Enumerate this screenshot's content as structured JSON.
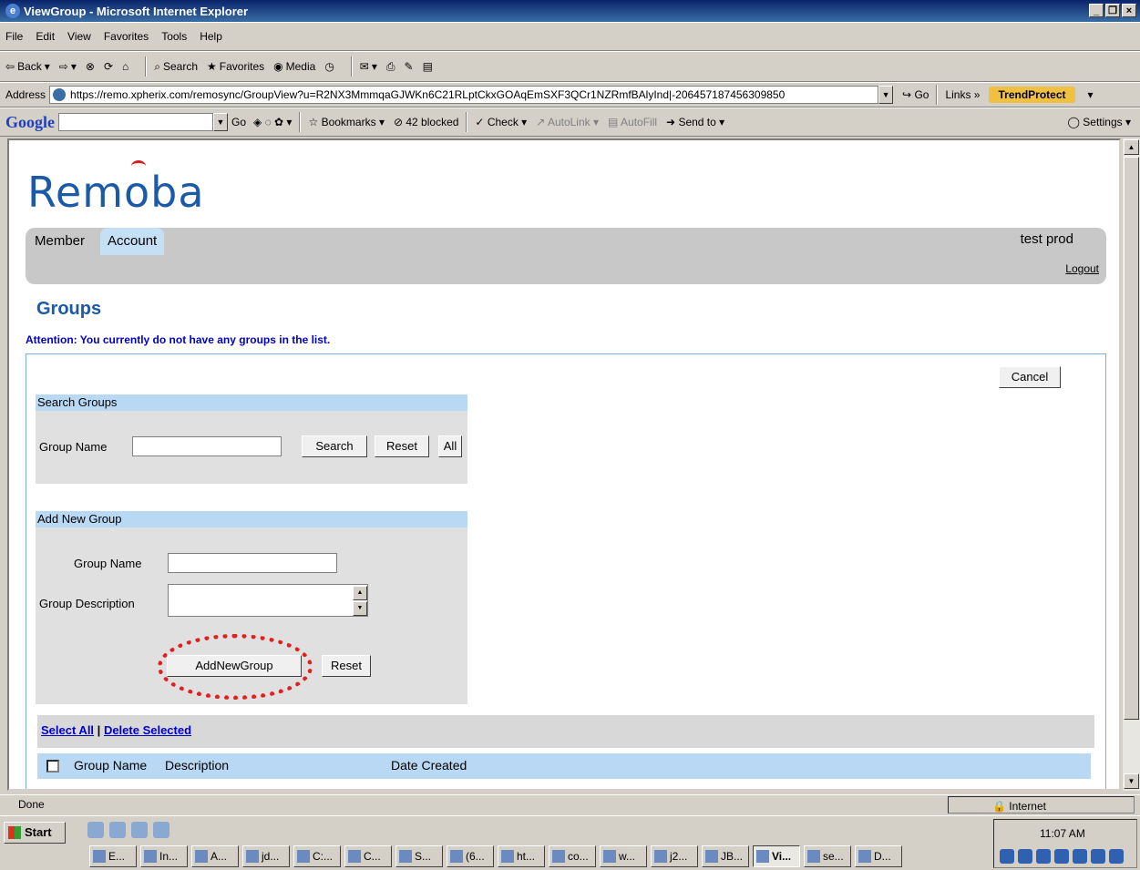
{
  "window": {
    "title": "ViewGroup - Microsoft Internet Explorer"
  },
  "menu": [
    "File",
    "Edit",
    "View",
    "Favorites",
    "Tools",
    "Help"
  ],
  "toolbar": {
    "back": "Back",
    "search": "Search",
    "favorites": "Favorites",
    "media": "Media"
  },
  "address": {
    "label": "Address",
    "url": "https://remo.xpherix.com/remosync/GroupView?u=R2NX3MmmqaGJWKn6C21RLptCkxGOAqEmSXF3QCr1NZRmfBAlyInd|-206457187456309850",
    "go": "Go",
    "links": "Links",
    "trend": "TrendProtect"
  },
  "google": {
    "logo": "Google",
    "go": "Go",
    "bookmarks": "Bookmarks",
    "blocked": "42 blocked",
    "check": "Check",
    "autolink": "AutoLink",
    "autofill": "AutoFill",
    "sendto": "Send to",
    "settings": "Settings"
  },
  "page": {
    "logo": "Remoba",
    "tabs": {
      "member": "Member",
      "account": "Account"
    },
    "user": "test prod",
    "logout": "Logout",
    "title": "Groups",
    "attention": "Attention: You currently do not have any groups in the list.",
    "cancel": "Cancel",
    "search_section": {
      "header": "Search Groups",
      "label": "Group Name",
      "value": "",
      "search": "Search",
      "reset": "Reset",
      "all": "All"
    },
    "add_section": {
      "header": "Add New Group",
      "name_label": "Group Name",
      "name_value": "",
      "desc_label": "Group Description",
      "desc_value": "",
      "add": "AddNewGroup",
      "reset": "Reset"
    },
    "list": {
      "select_all": "Select All",
      "separator": "|",
      "delete_selected": "Delete Selected",
      "columns": [
        "Group Name",
        "Description",
        "Date Created"
      ]
    }
  },
  "status": {
    "text": "Done",
    "zone": "Internet"
  },
  "taskbar": {
    "start": "Start",
    "clock": "11:07 AM",
    "tasks": [
      "E...",
      "In...",
      "A...",
      "jd...",
      "C:...",
      "C...",
      "S...",
      "(6...",
      "ht...",
      "co...",
      "w...",
      "j2...",
      "JB...",
      "Vi...",
      "se...",
      "D..."
    ]
  }
}
